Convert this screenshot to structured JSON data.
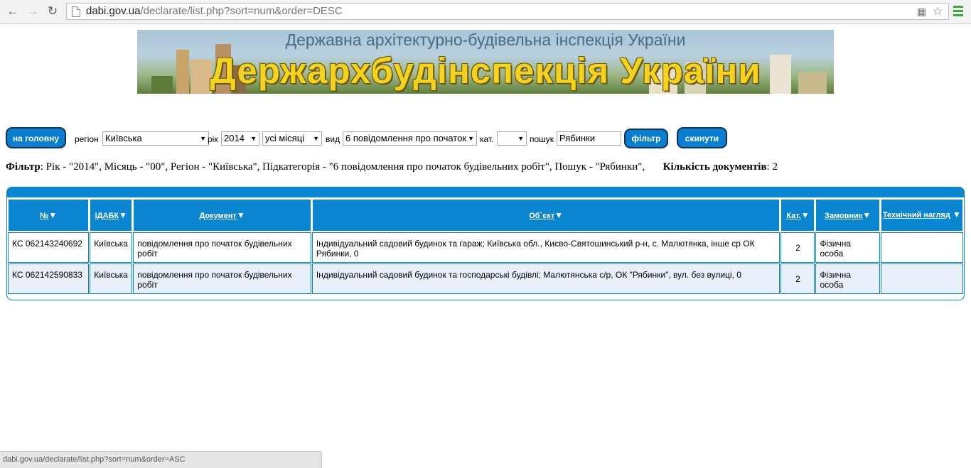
{
  "browser": {
    "url_domain": "dabi.gov.ua",
    "url_path": "/declarate/list.php?sort=num&order=DESC",
    "status_url": "dabi.gov.ua/declarate/list.php?sort=num&order=ASC",
    "icons": [
      "back-arrow-icon",
      "forward-arrow-icon",
      "reload-icon",
      "page-icon",
      "translate-icon",
      "star-icon",
      "menu-icon"
    ]
  },
  "banner": {
    "subtitle": "Державна архітектурно-будівельна інспекція України",
    "title": "Держархбудінспекція України"
  },
  "filter": {
    "home_button": "на головну",
    "region_label": "регіон",
    "region_value": "Київська",
    "year_label": "рік",
    "year_value": "2014",
    "month_value": "усі місяці",
    "type_label": "вид",
    "type_value": "6 повідомлення про початок",
    "category_label": "кат.",
    "category_value": "",
    "search_label": "пошук",
    "search_value": "Рябинки",
    "filter_button": "фільтр",
    "reset_button": "скинути"
  },
  "summary": {
    "filter_label": "Фільтр",
    "filter_text": ": Рік - \"2014\", Місяць - \"00\", Регіон - \"Київська\", Підкатегорія - \"6 повідомлення про початок будівельних робіт\", Пошук - \"Рябинки\",",
    "count_label": "Кількість документів",
    "count_value": ": 2"
  },
  "table": {
    "headers": [
      "№",
      "ІДАБК",
      "Документ",
      "Об`єкт",
      "Кат.",
      "Замовник",
      "Технічний нагляд"
    ],
    "rows": [
      {
        "num": "КС 062143240692",
        "idabk": "Київська",
        "document": "повідомлення про початок будівельних робіт",
        "object": "Індивідуальний садовий будинок та гараж; Київська обл., Києво-Святошинський р-н, с. Малютянка, інше ср ОК Рябинки, 0",
        "category": "2",
        "customer": "Фізична особа",
        "supervision": ""
      },
      {
        "num": "КС 062142590833",
        "idabk": "Київська",
        "document": "повідомлення про початок будівельних робіт",
        "object": "Індивідуальний садовий будинок та господарські будівлі; Малютянська с/р, ОК \"Рябинки\", вул. без вулиці, 0",
        "category": "2",
        "customer": "Фізична особа",
        "supervision": ""
      }
    ]
  }
}
